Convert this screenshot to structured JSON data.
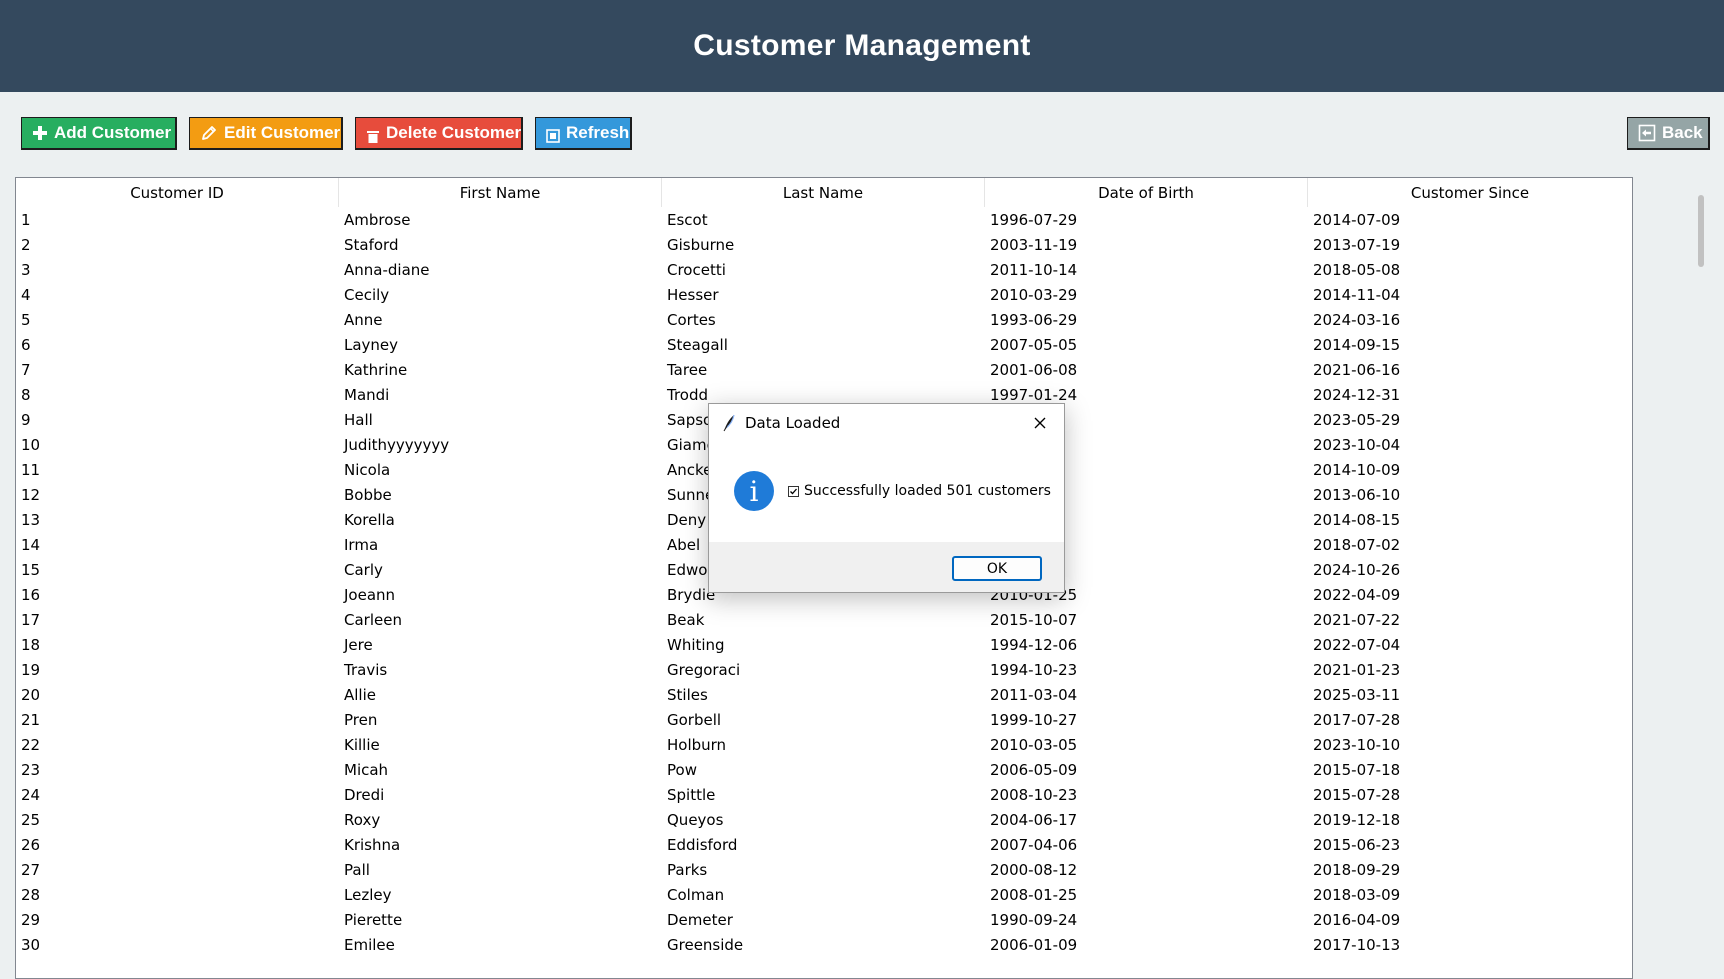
{
  "header": {
    "title": "Customer Management"
  },
  "toolbar": {
    "add_label": "Add Customer",
    "edit_label": "Edit Customer",
    "delete_label": "Delete Customer",
    "refresh_label": "Refresh",
    "back_label": "Back"
  },
  "table": {
    "columns": [
      "Customer ID",
      "First Name",
      "Last Name",
      "Date of Birth",
      "Customer Since"
    ],
    "rows": [
      [
        "1",
        "Ambrose",
        "Escot",
        "1996-07-29",
        "2014-07-09"
      ],
      [
        "2",
        "Staford",
        "Gisburne",
        "2003-11-19",
        "2013-07-19"
      ],
      [
        "3",
        "Anna-diane",
        "Crocetti",
        "2011-10-14",
        "2018-05-08"
      ],
      [
        "4",
        "Cecily",
        "Hesser",
        "2010-03-29",
        "2014-11-04"
      ],
      [
        "5",
        "Anne",
        "Cortes",
        "1993-06-29",
        "2024-03-16"
      ],
      [
        "6",
        "Layney",
        "Steagall",
        "2007-05-05",
        "2014-09-15"
      ],
      [
        "7",
        "Kathrine",
        "Taree",
        "2001-06-08",
        "2021-06-16"
      ],
      [
        "8",
        "Mandi",
        "Trodd",
        "1997-01-24",
        "2024-12-31"
      ],
      [
        "9",
        "Hall",
        "Sapsor",
        "",
        "2023-05-29"
      ],
      [
        "10",
        "Judithyyyyyyy",
        "Giame",
        "",
        "2023-10-04"
      ],
      [
        "11",
        "Nicola",
        "Ancke",
        "",
        "2014-10-09"
      ],
      [
        "12",
        "Bobbe",
        "Sunne",
        "",
        "2013-06-10"
      ],
      [
        "13",
        "Korella",
        "Deny",
        "",
        "2014-08-15"
      ],
      [
        "14",
        "Irma",
        "Abel",
        "",
        "2018-07-02"
      ],
      [
        "15",
        "Carly",
        "Edwor",
        "",
        "2024-10-26"
      ],
      [
        "16",
        "Joeann",
        "Brydie",
        "2010-01-25",
        "2022-04-09"
      ],
      [
        "17",
        "Carleen",
        "Beak",
        "2015-10-07",
        "2021-07-22"
      ],
      [
        "18",
        "Jere",
        "Whiting",
        "1994-12-06",
        "2022-07-04"
      ],
      [
        "19",
        "Travis",
        "Gregoraci",
        "1994-10-23",
        "2021-01-23"
      ],
      [
        "20",
        "Allie",
        "Stiles",
        "2011-03-04",
        "2025-03-11"
      ],
      [
        "21",
        "Pren",
        "Gorbell",
        "1999-10-27",
        "2017-07-28"
      ],
      [
        "22",
        "Killie",
        "Holburn",
        "2010-03-05",
        "2023-10-10"
      ],
      [
        "23",
        "Micah",
        "Pow",
        "2006-05-09",
        "2015-07-18"
      ],
      [
        "24",
        "Dredi",
        "Spittle",
        "2008-10-23",
        "2015-07-28"
      ],
      [
        "25",
        "Roxy",
        "Queyos",
        "2004-06-17",
        "2019-12-18"
      ],
      [
        "26",
        "Krishna",
        "Eddisford",
        "2007-04-06",
        "2015-06-23"
      ],
      [
        "27",
        "Pall",
        "Parks",
        "2000-08-12",
        "2018-09-29"
      ],
      [
        "28",
        "Lezley",
        "Colman",
        "2008-01-25",
        "2018-03-09"
      ],
      [
        "29",
        "Pierette",
        "Demeter",
        "1990-09-24",
        "2016-04-09"
      ],
      [
        "30",
        "Emilee",
        "Greenside",
        "2006-01-09",
        "2017-10-13"
      ]
    ]
  },
  "dialog": {
    "title": "Data Loaded",
    "message": "Successfully loaded 501 customers",
    "ok_label": "OK"
  },
  "colors": {
    "header_bg": "#34495e",
    "add": "#27ae60",
    "edit": "#f39c12",
    "delete": "#e74c3c",
    "refresh": "#3498db",
    "back": "#95a5a6"
  }
}
